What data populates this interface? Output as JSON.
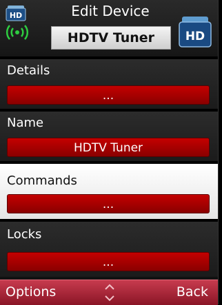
{
  "header": {
    "title": "Edit Device",
    "device_name": "HDTV Tuner",
    "hd_badge_small": "HD",
    "hd_badge_large": "HD"
  },
  "sections": [
    {
      "label": "Details",
      "value": "..."
    },
    {
      "label": "Name",
      "value": "HDTV Tuner"
    },
    {
      "label": "Commands",
      "value": "..."
    },
    {
      "label": "Locks",
      "value": "..."
    }
  ],
  "softkeys": {
    "left": "Options",
    "right": "Back"
  },
  "colors": {
    "field_red": "#b00000",
    "softkey_bar": "#a82236",
    "selected_bg": "#ffffff"
  }
}
